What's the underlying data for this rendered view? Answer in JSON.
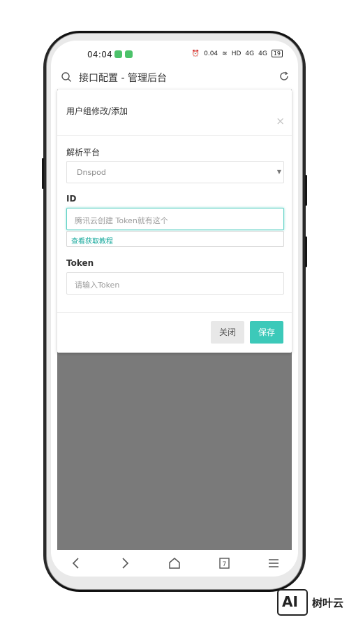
{
  "status_bar": {
    "time": "04:04",
    "speed": "0.04",
    "speed_unit": "KB/S",
    "hd": "HD",
    "signal1": "4G",
    "signal2": "4G",
    "battery": "19"
  },
  "browser": {
    "title": "接口配置 - 管理后台"
  },
  "modal": {
    "title": "用户组修改/添加",
    "close_symbol": "×",
    "platform_label": "解析平台",
    "platform_value": "Dnspod",
    "id_label": "ID",
    "id_placeholder": "腾讯云创建 Token就有这个",
    "tutorial_link": "查看获取教程",
    "token_label": "Token",
    "token_placeholder": "请输入Token",
    "close_button": "关闭",
    "save_button": "保存"
  },
  "nav": {
    "tabs_count": "7"
  },
  "watermark": {
    "logo": "AI",
    "text": "树叶云"
  },
  "colors": {
    "accent": "#3cc9b9",
    "link": "#18a99d",
    "overlay": "#7a7a7a"
  },
  "icons": [
    "search-icon",
    "refresh-icon",
    "back-icon",
    "forward-icon",
    "home-icon",
    "tabs-icon",
    "menu-icon",
    "close-icon",
    "caret-down-icon",
    "alarm-icon",
    "wifi-icon",
    "battery-icon"
  ]
}
